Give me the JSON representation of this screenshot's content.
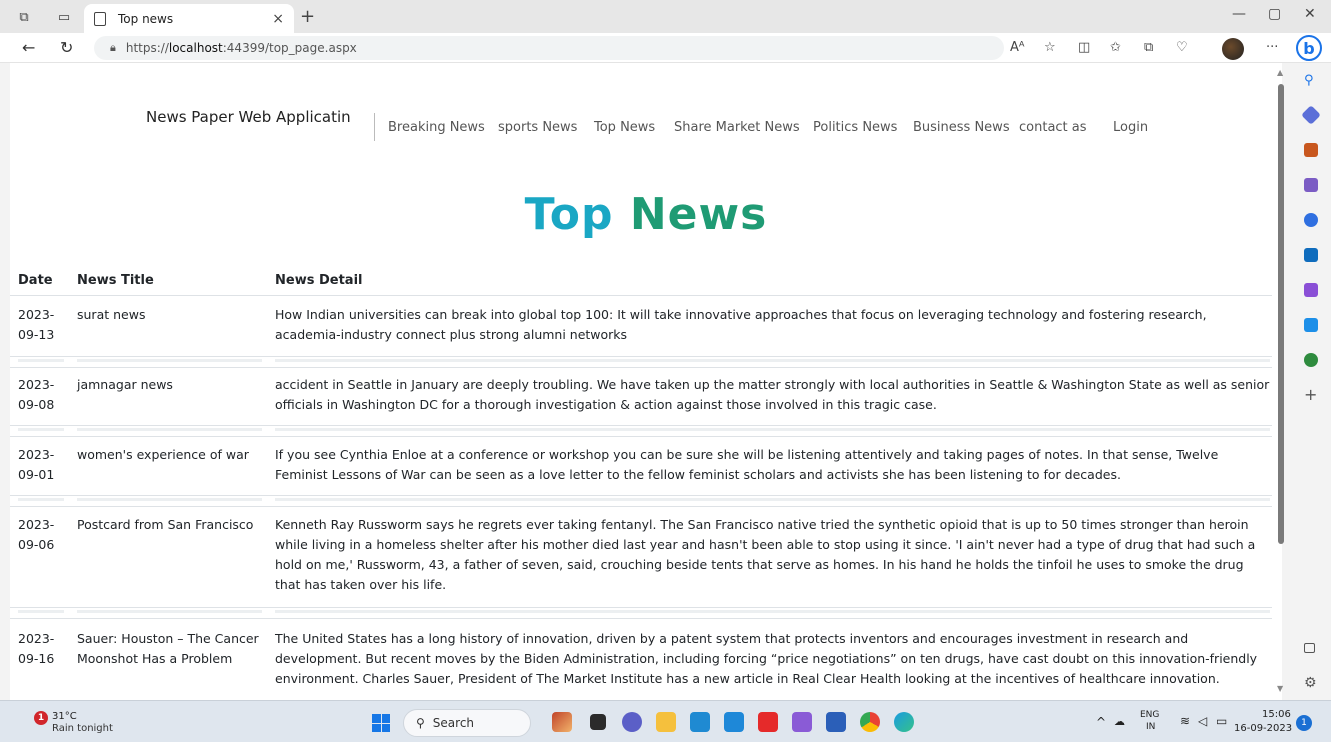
{
  "browser": {
    "tab_title": "Top news",
    "url_prefix": "https://",
    "url_host": "localhost",
    "url_rest": ":44399/top_page.aspx",
    "new_tab": "+",
    "close_tab": "×"
  },
  "site": {
    "brand": "News Paper Web Applicatin",
    "nav": [
      "Breaking News",
      "sports News",
      "Top News",
      "Share Market News",
      "Politics News",
      "Business News",
      "contact as",
      "Login"
    ],
    "heading_part1": "Top ",
    "heading_part2": "News",
    "heading_colors": [
      "#1aa7c4",
      "#1f9b74"
    ]
  },
  "table": {
    "headers": [
      "Date",
      "News Title",
      "News Detail"
    ],
    "rows": [
      {
        "date_y": "2023-",
        "date_md": "09-13",
        "title": "surat news",
        "detail": "How Indian universities can break into global top 100: It will take innovative approaches that focus on leveraging technology and fostering research, academia-industry connect plus strong alumni networks"
      },
      {
        "date_y": "2023-",
        "date_md": "09-08",
        "title": "jamnagar news",
        "detail": "accident in Seattle in January are deeply troubling. We have taken up the matter strongly with local authorities in Seattle & Washington State as well as senior officials in Washington DC for a thorough investigation & action against those involved in this tragic case."
      },
      {
        "date_y": "2023-",
        "date_md": "09-01",
        "title": "women's experience of war",
        "detail": "If you see Cynthia Enloe at a conference or workshop you can be sure she will be listening attentively and taking pages of notes. In that sense, Twelve Feminist Lessons of War can be seen as a love letter to the fellow feminist scholars and activists she has been listening to for decades."
      },
      {
        "date_y": "2023-",
        "date_md": "09-06",
        "title": "Postcard from San Francisco",
        "detail": "Kenneth Ray Russworm says he regrets ever taking fentanyl. The San Francisco native tried the synthetic opioid that is up to 50 times stronger than heroin while living in a homeless shelter after his mother died last year and hasn't been able to stop using it since. 'I ain't never had a type of drug that had such a hold on me,' Russworm, 43, a father of seven, said, crouching beside tents that serve as homes. In his hand he holds the tinfoil he uses to smoke the drug that has taken over his life."
      },
      {
        "date_y": "2023-",
        "date_md": "09-16",
        "title": "Sauer: Houston – The Cancer Moonshot Has a Problem",
        "detail": "The United States has a long history of innovation, driven by a patent system that protects inventors and encourages investment in research and development. But recent moves by the Biden Administration, including forcing “price negotiations” on ten drugs, have cast doubt on this innovation-friendly environment. Charles Sauer, President of The Market Institute has a new article in Real Clear Health looking at the incentives of healthcare innovation."
      }
    ]
  },
  "taskbar": {
    "weather_badge": "1",
    "temperature": "31°C",
    "weather_status": "Rain tonight",
    "search_placeholder": "Search",
    "lang_top": "ENG",
    "lang_bottom": "IN",
    "time": "15:06",
    "date": "16-09-2023",
    "notifications": "1"
  }
}
